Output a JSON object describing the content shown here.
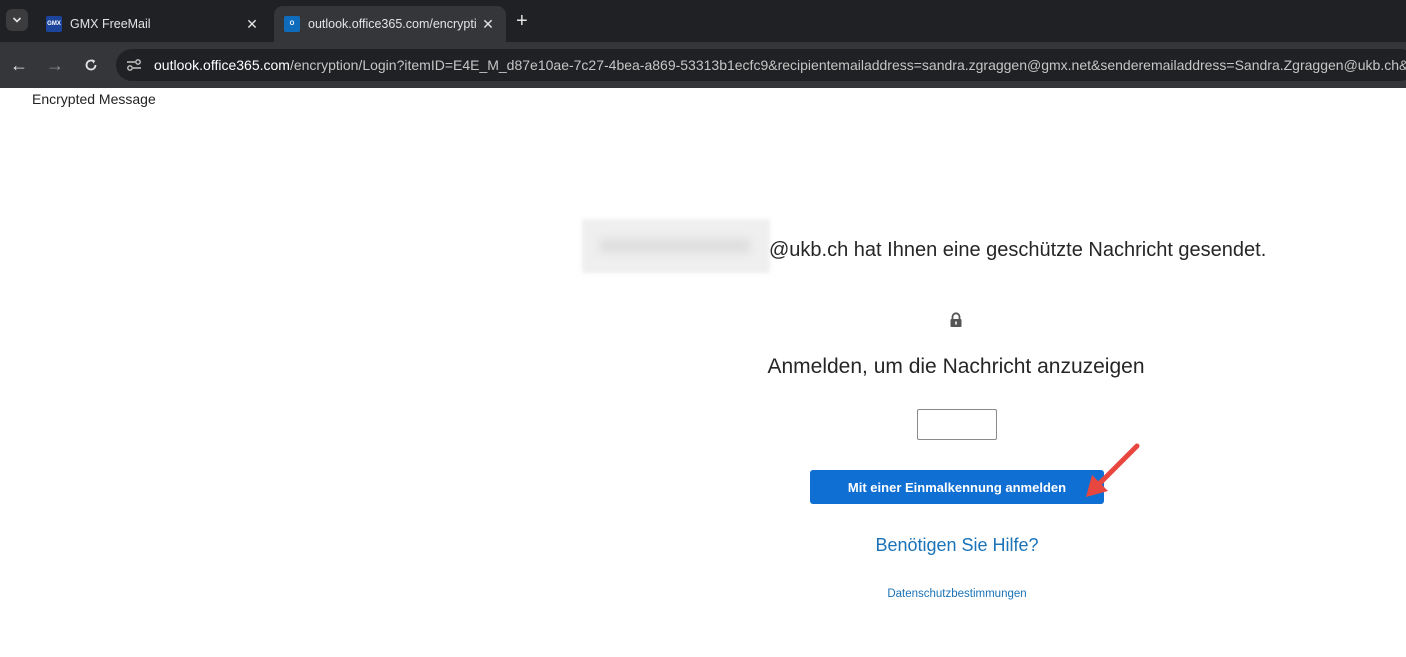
{
  "browser": {
    "tabs": [
      {
        "title": "GMX FreeMail",
        "favicon": "GMX",
        "active": false
      },
      {
        "title": "outlook.office365.com/encrypti",
        "favicon": "O",
        "active": true
      }
    ],
    "url_host": "outlook.office365.com",
    "url_path": "/encryption/Login?itemID=E4E_M_d87e10ae-7c27-4bea-a869-53313b1ecfc9&recipientemailaddress=sandra.zgraggen@gmx.net&senderemailaddress=Sandra.Zgraggen@ukb.ch&st"
  },
  "page": {
    "title": "Encrypted Message",
    "sender_suffix": "@ukb.ch hat Ihnen eine geschützte Nachricht gesendet.",
    "heading": "Anmelden, um die Nachricht anzuzeigen",
    "code_input_value": "",
    "primary_button": "Mit einer Einmalkennung anmelden",
    "help_link": "Benötigen Sie Hilfe?",
    "privacy_link": "Datenschutzbestimmungen"
  },
  "colors": {
    "accent": "#0f6fd3",
    "link": "#1a73b8",
    "annotation_arrow": "#e8473f"
  }
}
